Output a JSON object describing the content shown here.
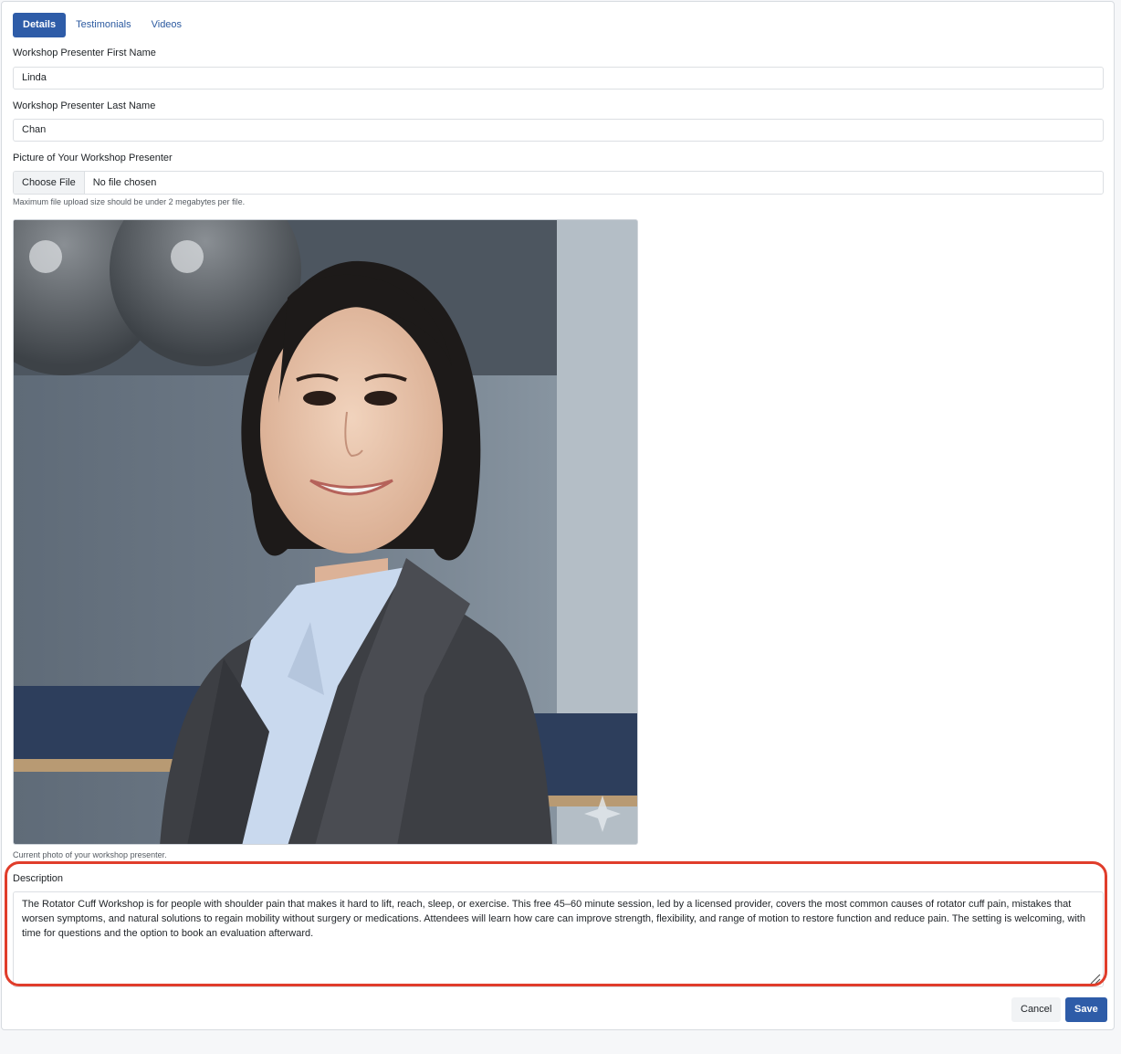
{
  "tabs": [
    {
      "label": "Details",
      "active": true
    },
    {
      "label": "Testimonials",
      "active": false
    },
    {
      "label": "Videos",
      "active": false
    }
  ],
  "form": {
    "first_name": {
      "label": "Workshop Presenter First Name",
      "value": "Linda"
    },
    "last_name": {
      "label": "Workshop Presenter Last Name",
      "value": "Chan"
    },
    "picture": {
      "label": "Picture of Your Workshop Presenter",
      "button_label": "Choose File",
      "status": "No file chosen",
      "hint": "Maximum file upload size should be under 2 megabytes per file.",
      "caption": "Current photo of your workshop presenter."
    },
    "description": {
      "label": "Description",
      "value": "The Rotator Cuff Workshop is for people with shoulder pain that makes it hard to lift, reach, sleep, or exercise. This free 45–60 minute session, led by a licensed provider, covers the most common causes of rotator cuff pain, mistakes that worsen symptoms, and natural solutions to regain mobility without surgery or medications. Attendees will learn how care can improve strength, flexibility, and range of motion to restore function and reduce pain. The setting is welcoming, with time for questions and the option to book an evaluation afterward."
    }
  },
  "actions": {
    "cancel_label": "Cancel",
    "save_label": "Save"
  },
  "colors": {
    "primary": "#2e5ca8",
    "highlight": "#e03d2b"
  }
}
